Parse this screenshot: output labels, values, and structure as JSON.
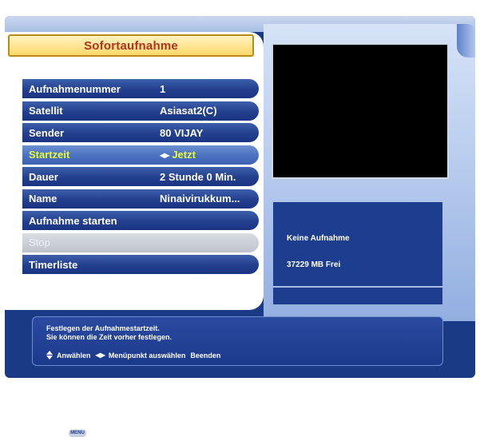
{
  "window": {
    "title": "Sofortaufnahme"
  },
  "menu": {
    "items": [
      {
        "label": "Aufnahmenummer",
        "value": "1"
      },
      {
        "label": "Satellit",
        "value": "Asiasat2(C)"
      },
      {
        "label": "Sender",
        "value": "80 VIJAY"
      },
      {
        "label": "Startzeit",
        "value": "Jetzt",
        "state": "selected"
      },
      {
        "label": "Dauer",
        "value": "2 Stunde 0 Min."
      },
      {
        "label": "Name",
        "value": "Ninaivirukkum..."
      },
      {
        "label": "Aufnahme starten",
        "value": ""
      },
      {
        "label": "Stop",
        "value": "",
        "state": "disabled"
      },
      {
        "label": "Timerliste",
        "value": ""
      }
    ]
  },
  "info": {
    "status": "Keine Aufnahme",
    "free_space": "37229 MB Frei"
  },
  "help": {
    "line1": "Festlegen der Aufnahmestartzeit.",
    "line2": "Sie können die Zeit vorher festlegen.",
    "key_updown_label": "Anwählen",
    "key_leftright_label": "Menüpunkt auswählen",
    "key_menu_glyph": "MENU",
    "key_menu_label": "Beenden"
  },
  "icons": {
    "updown": "up-down-arrows-icon",
    "leftright": "left-right-arrows-icon",
    "menu": "menu-key-icon"
  },
  "colors": {
    "title_text": "#b3331e",
    "title_bg": "#ffd86a",
    "selected_text": "#e6ff3a",
    "panel_blue": "#1d3d8e",
    "video_bg": "#000000"
  }
}
